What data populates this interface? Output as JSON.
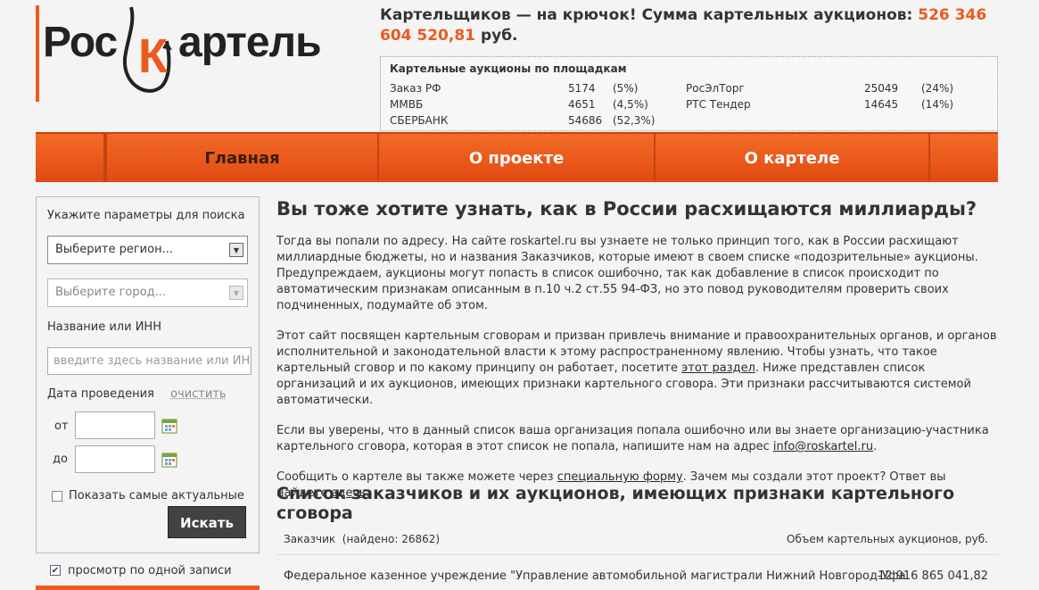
{
  "logo": {
    "part1": "Рос",
    "part2": "К",
    "part3": "артель"
  },
  "headline": {
    "text": "Картельщиков — на крючок! Сумма картельных аукционов:",
    "amount": "526 346 604 520,81",
    "currency": "руб."
  },
  "platforms": {
    "title": "Картельные аукционы по площадкам",
    "rows": [
      {
        "name": "Заказ РФ",
        "count": "5174",
        "pct": "(5%)"
      },
      {
        "name": "ММВБ",
        "count": "4651",
        "pct": "(4,5%)"
      },
      {
        "name": "СБЕРБАНК",
        "count": "54686",
        "pct": "(52,3%)"
      },
      {
        "name": "РосЭлТорг",
        "count": "25049",
        "pct": "(24%)"
      },
      {
        "name": "РТС Тендер",
        "count": "14645",
        "pct": "(14%)"
      }
    ]
  },
  "nav": {
    "home": "Главная",
    "about": "О проекте",
    "cartel": "О картеле"
  },
  "sidebar": {
    "title": "Укажите параметры для поиска",
    "region": "Выберите регион...",
    "city": "Выберите город...",
    "name_label": "Название или ИНН",
    "name_placeholder": "введите здесь название или ИНН",
    "date_label": "Дата проведения",
    "clear": "очистить",
    "from": "от",
    "to": "до",
    "actual": "Показать самые актуальные",
    "search": "Искать",
    "single": "просмотр по одной записи"
  },
  "main": {
    "h1": "Вы тоже хотите узнать, как в России расхищаются миллиарды?",
    "p1": "Тогда вы попали по адресу. На сайте roskartel.ru вы узнаете не только принцип того, как в России расхищают миллиардные бюджеты, но и названия Заказчиков, которые имеют в своем списке «подозрительные» аукционы. Предупреждаем, аукционы могут попасть в список ошибочно, так как добавление в список происходит по автоматическим признакам описанным в п.10 ч.2 ст.55 94-ФЗ, но это повод руководителям проверить своих подчиненных, подумайте об этом.",
    "p2a": "Этот сайт посвящен картельным сговорам и призван привлечь внимание и правоохранительных органов, и органов исполнительной и законодательной власти к этому распространенному явлению. Чтобы узнать, что такое картельный сговор и по какому принципу он работает, посетите",
    "p2link": "этот раздел",
    "p2b": ". Ниже представлен список организаций и их аукционов, имеющих признаки картельного сговора. Эти признаки рассчитываются системой автоматически.",
    "p3a": "Если вы уверены, что в данный список ваша организация попала ошибочно или вы знаете организацию-участника картельного сговора, которая в этот список не попала, напишите нам на адрес",
    "p3link": "info@roskartel.ru",
    "p3b": ".",
    "p4a": "Сообщить о картеле вы также можете через",
    "p4link1": "специальную форму",
    "p4b": ". Зачем мы создали этот проект? Ответ вы найдете",
    "p4link2": "здесь",
    "p4c": ".",
    "h2": "Список заказчиков и их аукционов, имеющих признаки картельного сговора",
    "table_left": "Заказчик  (найдено: 26862)",
    "table_right": "Объем картельных аукционов, руб.",
    "row1_name": "Федеральное казенное учреждение \"Управление автомобильной магистрали Нижний Новгород-Уфа",
    "row1_value": "12 916 865 041,82"
  }
}
